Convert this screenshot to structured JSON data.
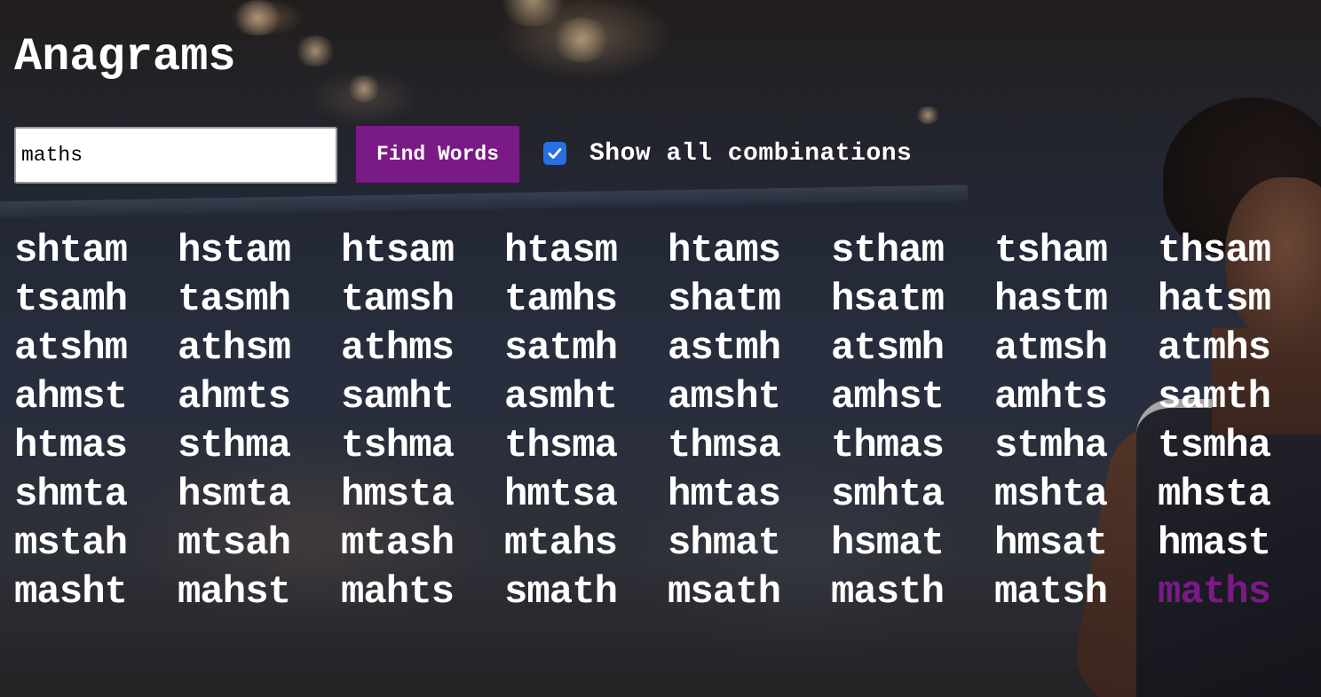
{
  "app": {
    "title": "Anagrams"
  },
  "controls": {
    "input_value": "maths",
    "find_button_label": "Find Words",
    "show_all_label": "Show all combinations",
    "show_all_checked": true
  },
  "results": {
    "words": [
      "shtam",
      "hstam",
      "htsam",
      "htasm",
      "htams",
      "stham",
      "tsham",
      "thsam",
      "tsamh",
      "tasmh",
      "tamsh",
      "tamhs",
      "shatm",
      "hsatm",
      "hastm",
      "hatsm",
      "atshm",
      "athsm",
      "athms",
      "satmh",
      "astmh",
      "atsmh",
      "atmsh",
      "atmhs",
      "ahmst",
      "ahmts",
      "samht",
      "asmht",
      "amsht",
      "amhst",
      "amhts",
      "samth",
      "htmas",
      "sthma",
      "tshma",
      "thsma",
      "thmsa",
      "thmas",
      "stmha",
      "tsmha",
      "shmta",
      "hsmta",
      "hmsta",
      "hmtsa",
      "hmtas",
      "smhta",
      "mshta",
      "mhsta",
      "mstah",
      "mtsah",
      "mtash",
      "mtahs",
      "shmat",
      "hsmat",
      "hmsat",
      "hmast",
      "masht",
      "mahst",
      "mahts",
      "smath",
      "msath",
      "masth",
      "matsh",
      "maths"
    ],
    "highlighted_word": "maths"
  },
  "theme": {
    "accent": "#7a1a86",
    "text": "#ffffff",
    "checkbox": "#2a6fe0"
  }
}
